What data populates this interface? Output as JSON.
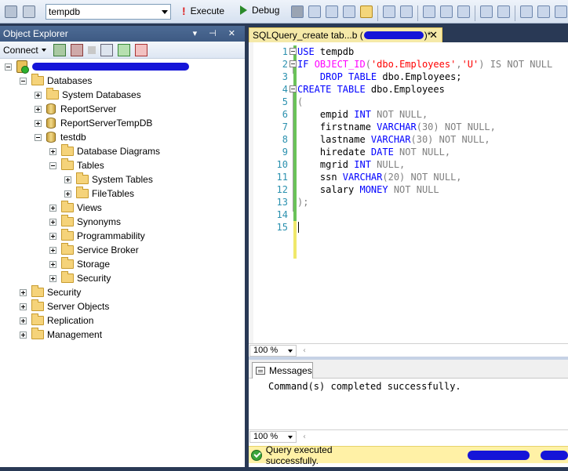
{
  "toolbar": {
    "database": "tempdb",
    "execute_label": "Execute",
    "debug_label": "Debug"
  },
  "object_explorer": {
    "title": "Object Explorer",
    "header_controls": "▾ ⊣ ✕",
    "connect_label": "Connect",
    "tree": [
      {
        "id": "server",
        "label": "",
        "level": 0,
        "expanded": true,
        "icon": "server-icon"
      },
      {
        "id": "databases",
        "label": "Databases",
        "level": 1,
        "expanded": true,
        "icon": "folder-icon"
      },
      {
        "id": "system-databases",
        "label": "System Databases",
        "level": 2,
        "expanded": false,
        "icon": "folder-icon"
      },
      {
        "id": "reportserver",
        "label": "ReportServer",
        "level": 2,
        "expanded": false,
        "icon": "database-icon"
      },
      {
        "id": "reportservertempdb",
        "label": "ReportServerTempDB",
        "level": 2,
        "expanded": false,
        "icon": "database-icon"
      },
      {
        "id": "testdb",
        "label": "testdb",
        "level": 2,
        "expanded": true,
        "icon": "database-icon"
      },
      {
        "id": "database-diagrams",
        "label": "Database Diagrams",
        "level": 3,
        "expanded": false,
        "icon": "folder-icon"
      },
      {
        "id": "tables",
        "label": "Tables",
        "level": 3,
        "expanded": true,
        "icon": "folder-icon"
      },
      {
        "id": "system-tables",
        "label": "System Tables",
        "level": 4,
        "expanded": false,
        "icon": "folder-icon"
      },
      {
        "id": "filetables",
        "label": "FileTables",
        "level": 4,
        "expanded": false,
        "icon": "folder-icon"
      },
      {
        "id": "views",
        "label": "Views",
        "level": 3,
        "expanded": false,
        "icon": "folder-icon"
      },
      {
        "id": "synonyms",
        "label": "Synonyms",
        "level": 3,
        "expanded": false,
        "icon": "folder-icon"
      },
      {
        "id": "programmability",
        "label": "Programmability",
        "level": 3,
        "expanded": false,
        "icon": "folder-icon"
      },
      {
        "id": "service-broker",
        "label": "Service Broker",
        "level": 3,
        "expanded": false,
        "icon": "folder-icon"
      },
      {
        "id": "storage",
        "label": "Storage",
        "level": 3,
        "expanded": false,
        "icon": "folder-icon"
      },
      {
        "id": "db-security",
        "label": "Security",
        "level": 3,
        "expanded": false,
        "icon": "folder-icon"
      },
      {
        "id": "security",
        "label": "Security",
        "level": 1,
        "expanded": false,
        "icon": "folder-icon"
      },
      {
        "id": "server-objects",
        "label": "Server Objects",
        "level": 1,
        "expanded": false,
        "icon": "folder-icon"
      },
      {
        "id": "replication",
        "label": "Replication",
        "level": 1,
        "expanded": false,
        "icon": "folder-icon"
      },
      {
        "id": "management",
        "label": "Management",
        "level": 1,
        "expanded": false,
        "icon": "folder-icon"
      }
    ]
  },
  "document": {
    "tab_label": "SQLQuery_create tab...b (",
    "tab_modified": ")*",
    "tab_close": "✕",
    "line_numbers": [
      "1",
      "2",
      "3",
      "4",
      "5",
      "6",
      "7",
      "8",
      "9",
      "10",
      "11",
      "12",
      "13",
      "14",
      "15"
    ],
    "code": {
      "l1_kw": "USE",
      "l1_txt": " tempdb",
      "l2_kw1": "IF",
      "l2_fn": "OBJECT_ID",
      "l2_p1": "(",
      "l2_str1": "'dbo.Employees'",
      "l2_comma": ",",
      "l2_str2": "'U'",
      "l2_p2": ")",
      "l2_kw2": " IS NOT NULL",
      "l3_kw": "    DROP TABLE",
      "l3_txt": " dbo.Employees;",
      "l4_kw": "CREATE TABLE",
      "l4_txt": " dbo.Employees",
      "l5": "(",
      "rows": [
        {
          "name": "    empid ",
          "type": "INT",
          "rest": " NOT NULL,"
        },
        {
          "name": "    firstname ",
          "type": "VARCHAR",
          "rest": "(30) NOT NULL,"
        },
        {
          "name": "    lastname ",
          "type": "VARCHAR",
          "rest": "(30) NOT NULL,"
        },
        {
          "name": "    hiredate ",
          "type": "DATE",
          "rest": " NOT NULL,"
        },
        {
          "name": "    mgrid ",
          "type": "INT",
          "rest": " NULL,"
        },
        {
          "name": "    ssn ",
          "type": "VARCHAR",
          "rest": "(20) NOT NULL,"
        },
        {
          "name": "    salary ",
          "type": "MONEY",
          "rest": " NOT NULL"
        }
      ],
      "l13": ");"
    },
    "zoom": "100 %",
    "results": {
      "tab_label": "Messages",
      "message": "Command(s) completed successfully.",
      "zoom": "100 %"
    },
    "status": "Query executed successfully."
  }
}
